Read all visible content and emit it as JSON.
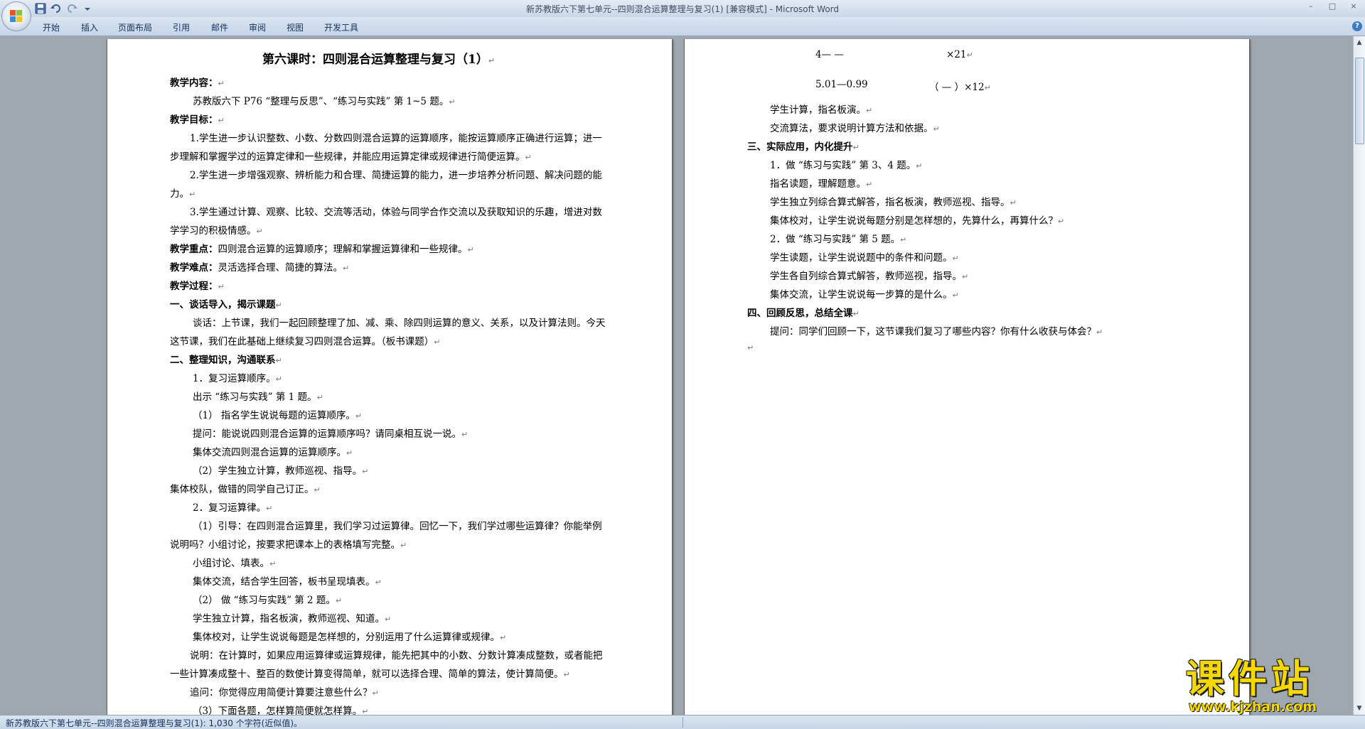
{
  "window": {
    "title": "新苏教版六下第七单元--四则混合运算整理与复习(1) [兼容模式] - Microsoft Word",
    "controls": [
      "–",
      "□",
      "×"
    ]
  },
  "ribbon": {
    "tabs": [
      "开始",
      "插入",
      "页面布局",
      "引用",
      "邮件",
      "审阅",
      "视图",
      "开发工具"
    ]
  },
  "page1": {
    "lines": [
      "第六课时：四则混合运算整理与复习（1）",
      "教学内容：",
      "苏教版六下 P76 “整理与反思”、“练习与实践” 第 1~5 题。",
      "教学目标：",
      "1.学生进一步认识整数、小数、分数四则混合运算的运算顺序，能按运算顺序正确进行运算；进一",
      "步理解和掌握学过的运算定律和一些规律，并能应用运算定律或规律进行简便运算。",
      "2.学生进一步增强观察、辨析能力和合理、简捷运算的能力，进一步培养分析问题、解决问题的能",
      "力。",
      "3.学生通过计算、观察、比较、交流等活动，体验与同学合作交流以及获取知识的乐趣，增进对数",
      "学学习的积极情感。",
      "教学重点：",
      "四则混合运算的运算顺序；理解和掌握运算律和一些规律。",
      "教学难点：",
      "灵活选择合理、简捷的算法。",
      "教学过程：",
      "一、谈话导入，揭示课题",
      "谈话：上节课，我们一起回顾整理了加、减、乘、除四则运算的意义、关系，以及计算法则。今天",
      "这节课，我们在此基础上继续复习四则混合运算。（板书课题）",
      "二、整理知识，沟通联系",
      "1．复习运算顺序。",
      "出示 “练习与实践” 第 1 题。",
      "（1）  指名学生说说每题的运算顺序。",
      "提问：能说说四则混合运算的运算顺序吗？请同桌相互说一说。",
      "集体交流四则混合运算的运算顺序。",
      "（2）学生独立计算，教师巡视、指导。",
      "集体校队，做错的同学自己订正。",
      "2．复习运算律。",
      "（1）引导：在四则混合运算里，我们学习过运算律。回忆一下，我们学过哪些运算律？你能举例",
      "说明吗？小组讨论，按要求把课本上的表格填写完整。",
      "小组讨论、填表。",
      "集体交流，结合学生回答，板书呈现填表。",
      "（2）  做 “练习与实践” 第 2 题。",
      "学生独立计算，指名板演，教师巡视、知道。",
      "集体校对，让学生说说每题是怎样想的，分别运用了什么运算律或规律。",
      "说明：在计算时，如果应用运算律或运算规律，能先把其中的小数、分数计算凑成整数，或者能把",
      "一些计算凑成整十、整百的数使计算变得简单，就可以选择合理、简单的算法，使计算简便。",
      "追问：你觉得应用简便计算要注意些什么？",
      "（3）下面各题，怎样算简便就怎样算。"
    ]
  },
  "page2": {
    "lines": [
      "4—  —",
      "×21",
      "5.01—0.99",
      "（  —  ）×12",
      "学生计算，指名板演。",
      "交流算法，要求说明计算方法和依据。",
      "三、实际应用，内化提升",
      "1．做 “练习与实践” 第 3、4 题。",
      "指名读题，理解题意。",
      "学生独立列综合算式解答，指名板演，教师巡视、指导。",
      "集体校对，让学生说说每题分别是怎样想的，先算什么，再算什么？",
      "2．做 “练习与实践” 第 5 题。",
      "学生读题，让学生说说题中的条件和问题。",
      "学生各自列综合算式解答，教师巡视，指导。",
      "集体交流，让学生说说每一步算的是什么。",
      "四、回顾反思，总结全课",
      "提问：同学们回顾一下，这节课我们复习了哪些内容？你有什么收获与体会？"
    ]
  },
  "paragraph_mark": "↵",
  "status": {
    "text": "新苏教版六下第七单元--四则混合运算整理与复习(1): 1,030 个字符(近似值)。"
  },
  "watermark": {
    "main": "课件站",
    "url": "www.kjzhan.com"
  },
  "icons": [
    "office-logo-icon",
    "save-icon",
    "undo-icon",
    "redo-icon",
    "customize-qat-icon",
    "help-icon",
    "scroll-up-icon",
    "scroll-down-icon"
  ],
  "colors": {
    "accent": "#15315b",
    "watermark": "#f5d800",
    "workspace": "#9ea6ae"
  }
}
